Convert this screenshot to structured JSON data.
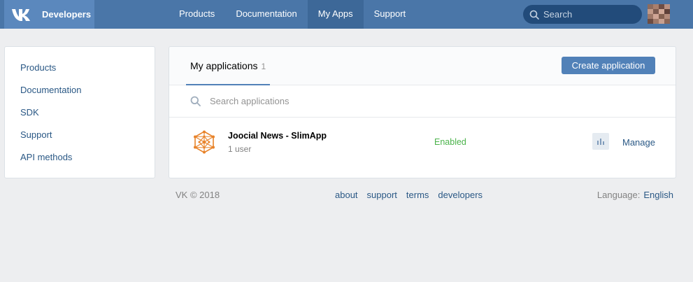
{
  "header": {
    "brand": "Developers",
    "nav": [
      {
        "label": "Products",
        "active": false
      },
      {
        "label": "Documentation",
        "active": false
      },
      {
        "label": "My Apps",
        "active": true
      },
      {
        "label": "Support",
        "active": false
      }
    ],
    "search_placeholder": "Search",
    "brand_color": "#4a76a8"
  },
  "sidebar": {
    "items": [
      {
        "label": "Products"
      },
      {
        "label": "Documentation"
      },
      {
        "label": "SDK"
      },
      {
        "label": "Support"
      },
      {
        "label": "API methods"
      }
    ]
  },
  "main": {
    "tab_label": "My applications",
    "tab_count": "1",
    "create_button": "Create application",
    "search_placeholder": "Search applications",
    "apps": [
      {
        "name": "Joocial News - SlimApp",
        "users": "1 user",
        "status": "Enabled",
        "manage": "Manage",
        "icon": "network-hexagon-icon"
      }
    ]
  },
  "footer": {
    "copyright": "VK © 2018",
    "links": [
      "about",
      "support",
      "terms",
      "developers"
    ],
    "language_label": "Language:",
    "language_value": "English"
  }
}
